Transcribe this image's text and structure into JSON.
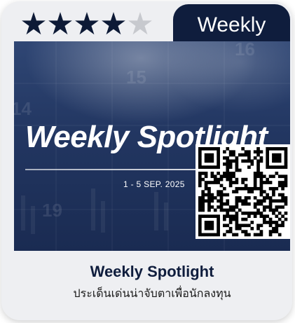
{
  "rating": {
    "value": 4,
    "max": 5
  },
  "tab": {
    "label": "Weekly"
  },
  "banner": {
    "headline": "Weekly Spotlight",
    "dates": "1 - 5 SEP. 2025"
  },
  "caption": {
    "title": "Weekly Spotlight",
    "subtitle": "ประเด็นเด่นน่าจับตาเพื่อนักลงทุน"
  },
  "colors": {
    "navy": "#0f1d3d",
    "star_on": "#0d1a36",
    "star_off": "#c7c9ce",
    "card_bg": "#eeeff2"
  },
  "icons": [
    "star-icon",
    "qr-code-icon"
  ]
}
